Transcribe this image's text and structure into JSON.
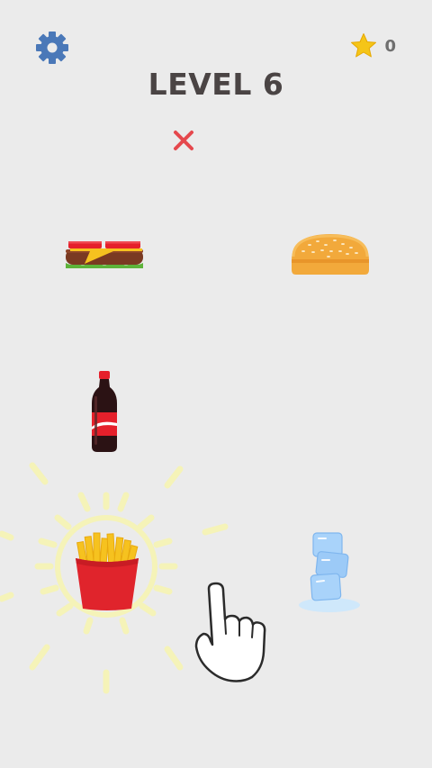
{
  "header": {
    "level_title": "LEVEL 6",
    "star_count": "0",
    "settings_icon": "gear-icon",
    "star_icon": "star-icon"
  },
  "feedback": {
    "icon": "wrong-mark-icon",
    "color": "#e5484d"
  },
  "items": [
    {
      "name": "cheeseburger",
      "icon": "cheeseburger-icon"
    },
    {
      "name": "burger-bun",
      "icon": "bun-icon"
    },
    {
      "name": "cola-bottle",
      "icon": "cola-bottle-icon"
    },
    {
      "name": "french-fries",
      "icon": "fries-icon",
      "highlighted": true
    },
    {
      "name": "ice-cubes",
      "icon": "ice-cubes-icon"
    }
  ],
  "tutorial": {
    "icon": "pointing-hand-icon"
  },
  "colors": {
    "background": "#ebebeb",
    "gear": "#4a78b8",
    "star": "#f5c518",
    "title": "#4a4444",
    "glow": "#f5f3b8"
  }
}
